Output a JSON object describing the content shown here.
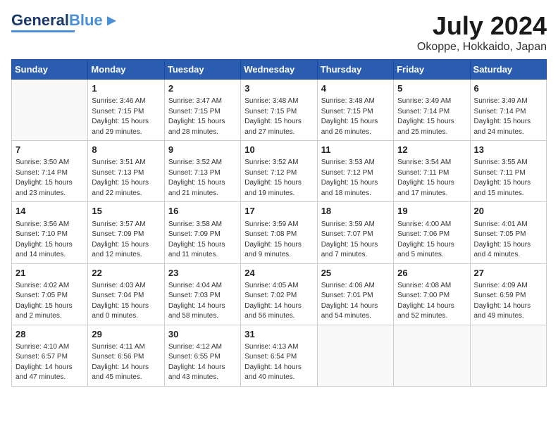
{
  "header": {
    "logo_general": "General",
    "logo_blue": "Blue",
    "month_year": "July 2024",
    "location": "Okoppe, Hokkaido, Japan"
  },
  "weekdays": [
    "Sunday",
    "Monday",
    "Tuesday",
    "Wednesday",
    "Thursday",
    "Friday",
    "Saturday"
  ],
  "weeks": [
    [
      null,
      {
        "day": 1,
        "sunrise": "3:46 AM",
        "sunset": "7:15 PM",
        "daylight": "15 hours and 29 minutes."
      },
      {
        "day": 2,
        "sunrise": "3:47 AM",
        "sunset": "7:15 PM",
        "daylight": "15 hours and 28 minutes."
      },
      {
        "day": 3,
        "sunrise": "3:48 AM",
        "sunset": "7:15 PM",
        "daylight": "15 hours and 27 minutes."
      },
      {
        "day": 4,
        "sunrise": "3:48 AM",
        "sunset": "7:15 PM",
        "daylight": "15 hours and 26 minutes."
      },
      {
        "day": 5,
        "sunrise": "3:49 AM",
        "sunset": "7:14 PM",
        "daylight": "15 hours and 25 minutes."
      },
      {
        "day": 6,
        "sunrise": "3:49 AM",
        "sunset": "7:14 PM",
        "daylight": "15 hours and 24 minutes."
      }
    ],
    [
      {
        "day": 7,
        "sunrise": "3:50 AM",
        "sunset": "7:14 PM",
        "daylight": "15 hours and 23 minutes."
      },
      {
        "day": 8,
        "sunrise": "3:51 AM",
        "sunset": "7:13 PM",
        "daylight": "15 hours and 22 minutes."
      },
      {
        "day": 9,
        "sunrise": "3:52 AM",
        "sunset": "7:13 PM",
        "daylight": "15 hours and 21 minutes."
      },
      {
        "day": 10,
        "sunrise": "3:52 AM",
        "sunset": "7:12 PM",
        "daylight": "15 hours and 19 minutes."
      },
      {
        "day": 11,
        "sunrise": "3:53 AM",
        "sunset": "7:12 PM",
        "daylight": "15 hours and 18 minutes."
      },
      {
        "day": 12,
        "sunrise": "3:54 AM",
        "sunset": "7:11 PM",
        "daylight": "15 hours and 17 minutes."
      },
      {
        "day": 13,
        "sunrise": "3:55 AM",
        "sunset": "7:11 PM",
        "daylight": "15 hours and 15 minutes."
      }
    ],
    [
      {
        "day": 14,
        "sunrise": "3:56 AM",
        "sunset": "7:10 PM",
        "daylight": "15 hours and 14 minutes."
      },
      {
        "day": 15,
        "sunrise": "3:57 AM",
        "sunset": "7:09 PM",
        "daylight": "15 hours and 12 minutes."
      },
      {
        "day": 16,
        "sunrise": "3:58 AM",
        "sunset": "7:09 PM",
        "daylight": "15 hours and 11 minutes."
      },
      {
        "day": 17,
        "sunrise": "3:59 AM",
        "sunset": "7:08 PM",
        "daylight": "15 hours and 9 minutes."
      },
      {
        "day": 18,
        "sunrise": "3:59 AM",
        "sunset": "7:07 PM",
        "daylight": "15 hours and 7 minutes."
      },
      {
        "day": 19,
        "sunrise": "4:00 AM",
        "sunset": "7:06 PM",
        "daylight": "15 hours and 5 minutes."
      },
      {
        "day": 20,
        "sunrise": "4:01 AM",
        "sunset": "7:05 PM",
        "daylight": "15 hours and 4 minutes."
      }
    ],
    [
      {
        "day": 21,
        "sunrise": "4:02 AM",
        "sunset": "7:05 PM",
        "daylight": "15 hours and 2 minutes."
      },
      {
        "day": 22,
        "sunrise": "4:03 AM",
        "sunset": "7:04 PM",
        "daylight": "15 hours and 0 minutes."
      },
      {
        "day": 23,
        "sunrise": "4:04 AM",
        "sunset": "7:03 PM",
        "daylight": "14 hours and 58 minutes."
      },
      {
        "day": 24,
        "sunrise": "4:05 AM",
        "sunset": "7:02 PM",
        "daylight": "14 hours and 56 minutes."
      },
      {
        "day": 25,
        "sunrise": "4:06 AM",
        "sunset": "7:01 PM",
        "daylight": "14 hours and 54 minutes."
      },
      {
        "day": 26,
        "sunrise": "4:08 AM",
        "sunset": "7:00 PM",
        "daylight": "14 hours and 52 minutes."
      },
      {
        "day": 27,
        "sunrise": "4:09 AM",
        "sunset": "6:59 PM",
        "daylight": "14 hours and 49 minutes."
      }
    ],
    [
      {
        "day": 28,
        "sunrise": "4:10 AM",
        "sunset": "6:57 PM",
        "daylight": "14 hours and 47 minutes."
      },
      {
        "day": 29,
        "sunrise": "4:11 AM",
        "sunset": "6:56 PM",
        "daylight": "14 hours and 45 minutes."
      },
      {
        "day": 30,
        "sunrise": "4:12 AM",
        "sunset": "6:55 PM",
        "daylight": "14 hours and 43 minutes."
      },
      {
        "day": 31,
        "sunrise": "4:13 AM",
        "sunset": "6:54 PM",
        "daylight": "14 hours and 40 minutes."
      },
      null,
      null,
      null
    ]
  ]
}
